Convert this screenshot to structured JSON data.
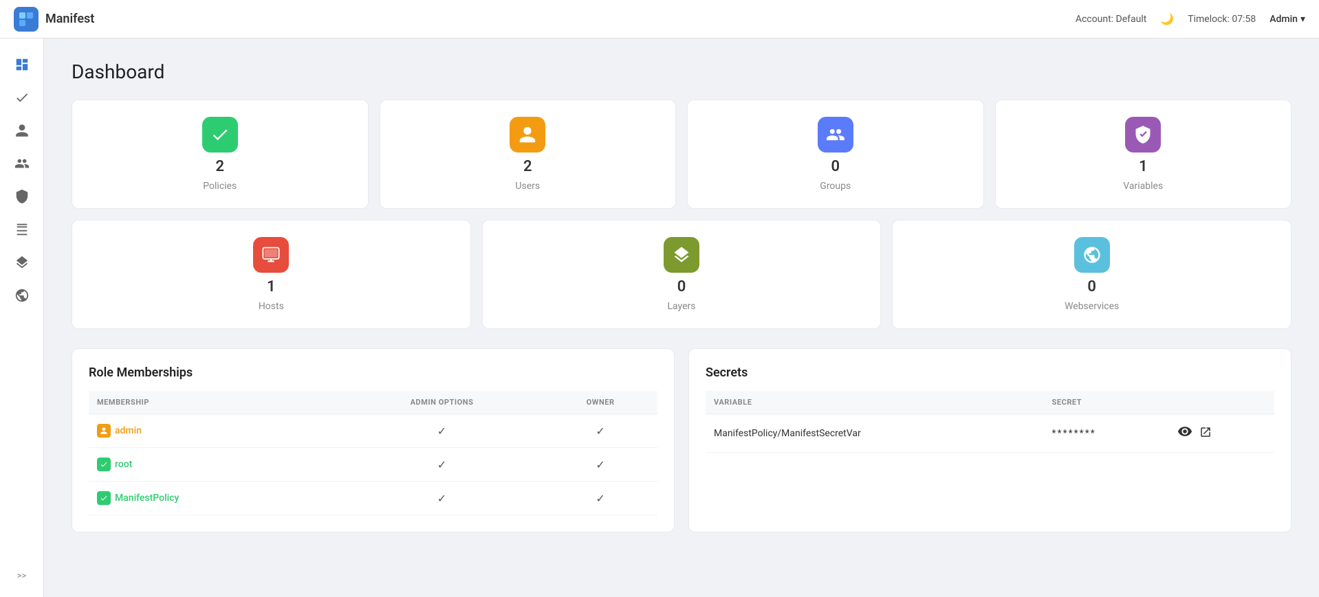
{
  "app": {
    "name": "Manifest",
    "logo_symbol": "🟦"
  },
  "topbar": {
    "account_label": "Account: Default",
    "timelock_label": "Timelock: 07:58",
    "admin_label": "Admin"
  },
  "sidebar": {
    "items": [
      {
        "name": "dashboard",
        "icon": "📊",
        "active": true
      },
      {
        "name": "tasks",
        "icon": "✅",
        "active": false
      },
      {
        "name": "user",
        "icon": "👤",
        "active": false
      },
      {
        "name": "groups",
        "icon": "👥",
        "active": false
      },
      {
        "name": "shield",
        "icon": "🛡️",
        "active": false
      },
      {
        "name": "servers",
        "icon": "🖥️",
        "active": false
      },
      {
        "name": "layers",
        "icon": "📚",
        "active": false
      },
      {
        "name": "globe",
        "icon": "🌐",
        "active": false
      }
    ],
    "expand_label": ">>"
  },
  "page": {
    "title": "Dashboard"
  },
  "cards_row1": [
    {
      "id": "policies",
      "icon_class": "icon-green",
      "icon": "✔",
      "count": "2",
      "label": "Policies"
    },
    {
      "id": "users",
      "icon_class": "icon-orange",
      "icon": "👤",
      "count": "2",
      "label": "Users"
    },
    {
      "id": "groups",
      "icon_class": "icon-blue-dark",
      "icon": "👥",
      "count": "0",
      "label": "Groups"
    },
    {
      "id": "variables",
      "icon_class": "icon-purple",
      "icon": "🔐",
      "count": "1",
      "label": "Variables"
    }
  ],
  "cards_row2": [
    {
      "id": "hosts",
      "icon_class": "icon-red",
      "icon": "🖥",
      "count": "1",
      "label": "Hosts"
    },
    {
      "id": "layers",
      "icon_class": "icon-olive",
      "icon": "📚",
      "count": "0",
      "label": "Layers"
    },
    {
      "id": "webservices",
      "icon_class": "icon-cyan",
      "icon": "🌐",
      "count": "0",
      "label": "Webservices"
    }
  ],
  "role_memberships": {
    "title": "Role Memberships",
    "columns": {
      "membership": "Membership",
      "admin_options": "Admin Options",
      "owner": "Owner"
    },
    "rows": [
      {
        "name": "admin",
        "color": "orange",
        "icon_bg": "#f39c12",
        "admin_options": true,
        "owner": true
      },
      {
        "name": "root",
        "color": "green",
        "icon_bg": "#2ecc71",
        "admin_options": true,
        "owner": true
      },
      {
        "name": "ManifestPolicy",
        "color": "green",
        "icon_bg": "#2ecc71",
        "admin_options": true,
        "owner": true
      }
    ]
  },
  "secrets": {
    "title": "Secrets",
    "columns": {
      "variable": "Variable",
      "secret": "Secret"
    },
    "rows": [
      {
        "variable": "ManifestPolicy/ManifestSecretVar",
        "secret": "********"
      }
    ]
  }
}
